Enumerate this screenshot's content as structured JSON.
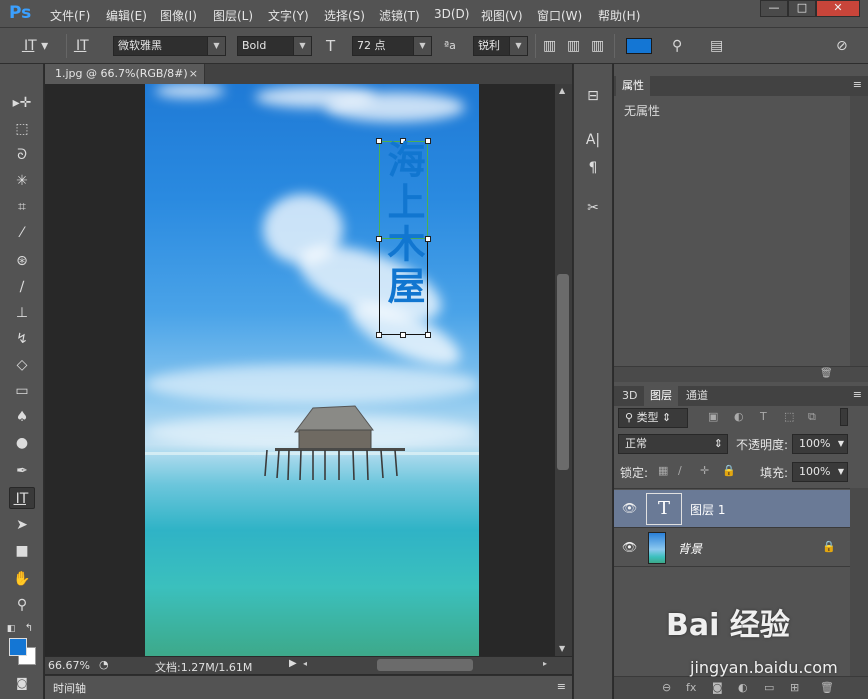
{
  "app": {
    "logo": "Ps",
    "menu": [
      "文件(F)",
      "编辑(E)",
      "图像(I)",
      "图层(L)",
      "文字(Y)",
      "选择(S)",
      "滤镜(T)",
      "3D(D)",
      "视图(V)",
      "窗口(W)",
      "帮助(H)"
    ],
    "window_buttons": [
      "—",
      "□",
      "✕"
    ]
  },
  "options_bar": {
    "font_family": "微软雅黑",
    "font_style": "Bold",
    "font_size": "72 点",
    "antialias": "锐利",
    "text_color": "#1476d4"
  },
  "document": {
    "tab_title": "1.jpg @ 66.7%(RGB/8#)",
    "close_glyph": "×",
    "vertical_text": "海上木屋",
    "text_color": "#1176d0"
  },
  "status": {
    "zoom": "66.67%",
    "doc_info": "文档:1.27M/1.61M"
  },
  "timeline": {
    "label": "时间轴"
  },
  "properties_panel": {
    "tab": "属性",
    "empty_text": "无属性"
  },
  "layers_panel": {
    "tabs": [
      "3D",
      "图层",
      "通道"
    ],
    "filter_kind": "类型",
    "blend_mode": "正常",
    "opacity_label": "不透明度:",
    "opacity_value": "100%",
    "lock_label": "锁定:",
    "fill_label": "填充:",
    "fill_value": "100%",
    "layers": [
      {
        "name": "图层 1",
        "type": "text",
        "selected": true
      },
      {
        "name": "背景",
        "type": "image",
        "locked": true
      }
    ]
  },
  "watermark": {
    "brand": "Bai 经验",
    "url": "jingyan.baidu.com"
  },
  "colors": {
    "foreground": "#1476d4",
    "background": "#ffffff",
    "ui_panel": "#535353"
  }
}
